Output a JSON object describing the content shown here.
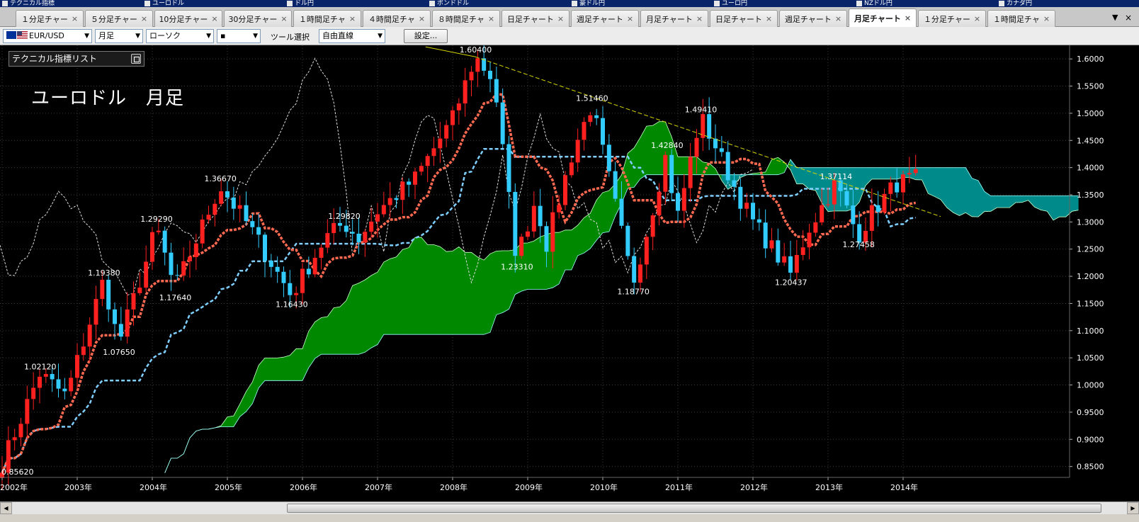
{
  "top_strip": [
    "テクニカル指標",
    "ユーロドル",
    "ドル円",
    "ポンドドル",
    "豪ドル円",
    "ユーロ円",
    "NZドル円",
    "カナダ円"
  ],
  "tabs": [
    {
      "label": "１分足チャー",
      "active": false
    },
    {
      "label": "５分足チャー",
      "active": false
    },
    {
      "label": "10分足チャー",
      "active": false
    },
    {
      "label": "30分足チャー",
      "active": false
    },
    {
      "label": "１時間足チャ",
      "active": false
    },
    {
      "label": "４時間足チャ",
      "active": false
    },
    {
      "label": "８時間足チャ",
      "active": false
    },
    {
      "label": "日足チャート",
      "active": false
    },
    {
      "label": "週足チャート",
      "active": false
    },
    {
      "label": "月足チャート",
      "active": false
    },
    {
      "label": "日足チャート",
      "active": false
    },
    {
      "label": "週足チャート",
      "active": false
    },
    {
      "label": "月足チャート",
      "active": true
    },
    {
      "label": "１分足チャー",
      "active": false
    },
    {
      "label": "１時間足チャ",
      "active": false
    }
  ],
  "tab_close_glyph": "×",
  "tab_menu_glyph": "▼",
  "tab_close_all_glyph": "×",
  "toolbar": {
    "currency_pair": "EUR/USD",
    "timeframe": "月足",
    "chart_type": "ローソク",
    "line_style": "▪",
    "tool_label": "ツール選択",
    "tool_value": "自由直線",
    "settings_label": "設定..."
  },
  "indicator_panel": {
    "label": "テクニカル指標リスト"
  },
  "chart_title": "ユーロドル　月足",
  "scroll_left_glyph": "◀",
  "scroll_right_glyph": "▶",
  "colors": {
    "bull": "#ff2020",
    "bear": "#33ccff",
    "kumo_bull": "#008800",
    "kumo_bear": "#008b8b",
    "tenkan": "#ff6a50",
    "kijun": "#7fcfff",
    "chikou": "#dddddd",
    "trendline": "#d6d600",
    "axis_text": "#ffffff"
  },
  "chart_data": {
    "type": "candlestick",
    "pair": "EUR/USD",
    "timeframe": "monthly",
    "ylim": [
      0.83,
      1.625
    ],
    "yticks": [
      "1.6000",
      "1.5500",
      "1.5000",
      "1.4500",
      "1.4000",
      "1.3500",
      "1.3000",
      "1.2500",
      "1.2000",
      "1.1500",
      "1.1000",
      "1.0500",
      "1.0000",
      "0.9500",
      "0.9000",
      "0.8500"
    ],
    "xlim": [
      2002.0,
      2014.0
    ],
    "xticks": [
      "2002年",
      "2003年",
      "2004年",
      "2005年",
      "2006年",
      "2007年",
      "2008年",
      "2009年",
      "2010年",
      "2011年",
      "2012年",
      "2013年",
      "2014年"
    ],
    "anchors": [
      [
        2002.0,
        0.8562
      ],
      [
        2002.5,
        1.0212
      ],
      [
        2002.85,
        0.98
      ],
      [
        2003.35,
        1.1938
      ],
      [
        2003.55,
        1.0765
      ],
      [
        2003.95,
        1.24
      ],
      [
        2004.05,
        1.2929
      ],
      [
        2004.3,
        1.1764
      ],
      [
        2004.9,
        1.3667
      ],
      [
        2005.3,
        1.29
      ],
      [
        2005.85,
        1.1643
      ],
      [
        2006.3,
        1.27
      ],
      [
        2006.55,
        1.2982
      ],
      [
        2006.75,
        1.27
      ],
      [
        2007.0,
        1.32
      ],
      [
        2007.5,
        1.38
      ],
      [
        2008.0,
        1.49
      ],
      [
        2008.3,
        1.604
      ],
      [
        2008.55,
        1.56
      ],
      [
        2008.85,
        1.2331
      ],
      [
        2009.1,
        1.34
      ],
      [
        2009.25,
        1.26
      ],
      [
        2009.6,
        1.43
      ],
      [
        2009.85,
        1.5146
      ],
      [
        2010.05,
        1.4
      ],
      [
        2010.4,
        1.1877
      ],
      [
        2010.6,
        1.29
      ],
      [
        2010.85,
        1.4284
      ],
      [
        2010.98,
        1.3
      ],
      [
        2011.3,
        1.4941
      ],
      [
        2011.5,
        1.44
      ],
      [
        2011.8,
        1.35
      ],
      [
        2012.0,
        1.3
      ],
      [
        2012.5,
        1.2044
      ],
      [
        2012.75,
        1.29
      ],
      [
        2013.1,
        1.3711
      ],
      [
        2013.4,
        1.2746
      ],
      [
        2013.6,
        1.32
      ],
      [
        2013.9,
        1.37
      ],
      [
        2014.15,
        1.38
      ]
    ],
    "labels": [
      {
        "text": "0.85620",
        "x": 2002.0,
        "y": 0.8562,
        "pos": "below"
      },
      {
        "text": "1.02120",
        "x": 2002.5,
        "y": 1.0212,
        "pos": "above"
      },
      {
        "text": "1.19380",
        "x": 2003.35,
        "y": 1.1938,
        "pos": "above"
      },
      {
        "text": "1.07650",
        "x": 2003.55,
        "y": 1.0765,
        "pos": "below"
      },
      {
        "text": "1.29290",
        "x": 2004.05,
        "y": 1.2929,
        "pos": "above"
      },
      {
        "text": "1.17640",
        "x": 2004.3,
        "y": 1.1764,
        "pos": "below"
      },
      {
        "text": "1.36670",
        "x": 2004.9,
        "y": 1.3667,
        "pos": "above"
      },
      {
        "text": "1.16430",
        "x": 2005.85,
        "y": 1.1643,
        "pos": "below"
      },
      {
        "text": "1.29820",
        "x": 2006.55,
        "y": 1.2982,
        "pos": "above"
      },
      {
        "text": "1.60400",
        "x": 2008.3,
        "y": 1.604,
        "pos": "above"
      },
      {
        "text": "1.23310",
        "x": 2008.85,
        "y": 1.2331,
        "pos": "below"
      },
      {
        "text": "1.51460",
        "x": 2009.85,
        "y": 1.5146,
        "pos": "above"
      },
      {
        "text": "1.18770",
        "x": 2010.4,
        "y": 1.1877,
        "pos": "below"
      },
      {
        "text": "1.42840",
        "x": 2010.85,
        "y": 1.4284,
        "pos": "above"
      },
      {
        "text": "1.49410",
        "x": 2011.3,
        "y": 1.4941,
        "pos": "above"
      },
      {
        "text": "1.20437",
        "x": 2012.5,
        "y": 1.2044,
        "pos": "below"
      },
      {
        "text": "1.37114",
        "x": 2013.1,
        "y": 1.3711,
        "pos": "above"
      },
      {
        "text": "1.27458",
        "x": 2013.4,
        "y": 1.2746,
        "pos": "below"
      }
    ],
    "trendline": [
      [
        2008.3,
        1.604
      ],
      [
        2014.5,
        1.31
      ]
    ],
    "indicators": [
      "ローソク足",
      "転換線",
      "基準線",
      "遅行スパン",
      "雲"
    ]
  }
}
